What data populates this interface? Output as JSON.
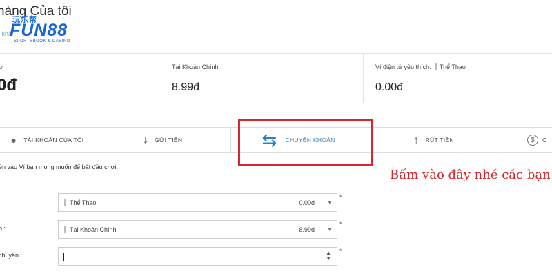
{
  "header": {
    "title": "hàng Của tôi",
    "subtitle": "i khả",
    "logo": {
      "top": "玩乐帮",
      "main": "FUN88",
      "tagline": "SPORTSBOOK & CASINO"
    }
  },
  "balances": [
    {
      "label": "ư",
      "value": "0đ"
    },
    {
      "label": "Tài Khoản Chính",
      "value": "8.99đ"
    },
    {
      "label": "Ví điện tử yêu thích:",
      "pill": "Thể Thao",
      "value": "0.00đ"
    }
  ],
  "tabs": [
    {
      "label": "TÀI KHOẢN CỦA TÔI",
      "icon": "account-icon"
    },
    {
      "label": "GỬI TIỀN",
      "icon": "download-icon"
    },
    {
      "label": "CHUYỂN KHOẢN",
      "icon": "transfer-arrows-icon"
    },
    {
      "label": "RÚT TIỀN",
      "icon": "upload-icon"
    },
    {
      "label": "C",
      "icon": "dollar-circle-icon"
    }
  ],
  "annotation": "Bấm vào đây nhé các bạn",
  "instruction": "ền vào Ví bạn mong muốn để bắt đầu chơi.",
  "form": {
    "from": {
      "label": ":",
      "wallet": "Thể Thao",
      "amount": "0.00đ"
    },
    "to": {
      "label": "o :",
      "wallet": "Tài Khoản Chính",
      "amount": "8.99đ"
    },
    "amount": {
      "label": "chuyển :",
      "value": ""
    },
    "required_mark": "*"
  },
  "colors": {
    "accent": "#2b7fc5",
    "highlight": "#d9252b",
    "logo": "#1566d8"
  }
}
